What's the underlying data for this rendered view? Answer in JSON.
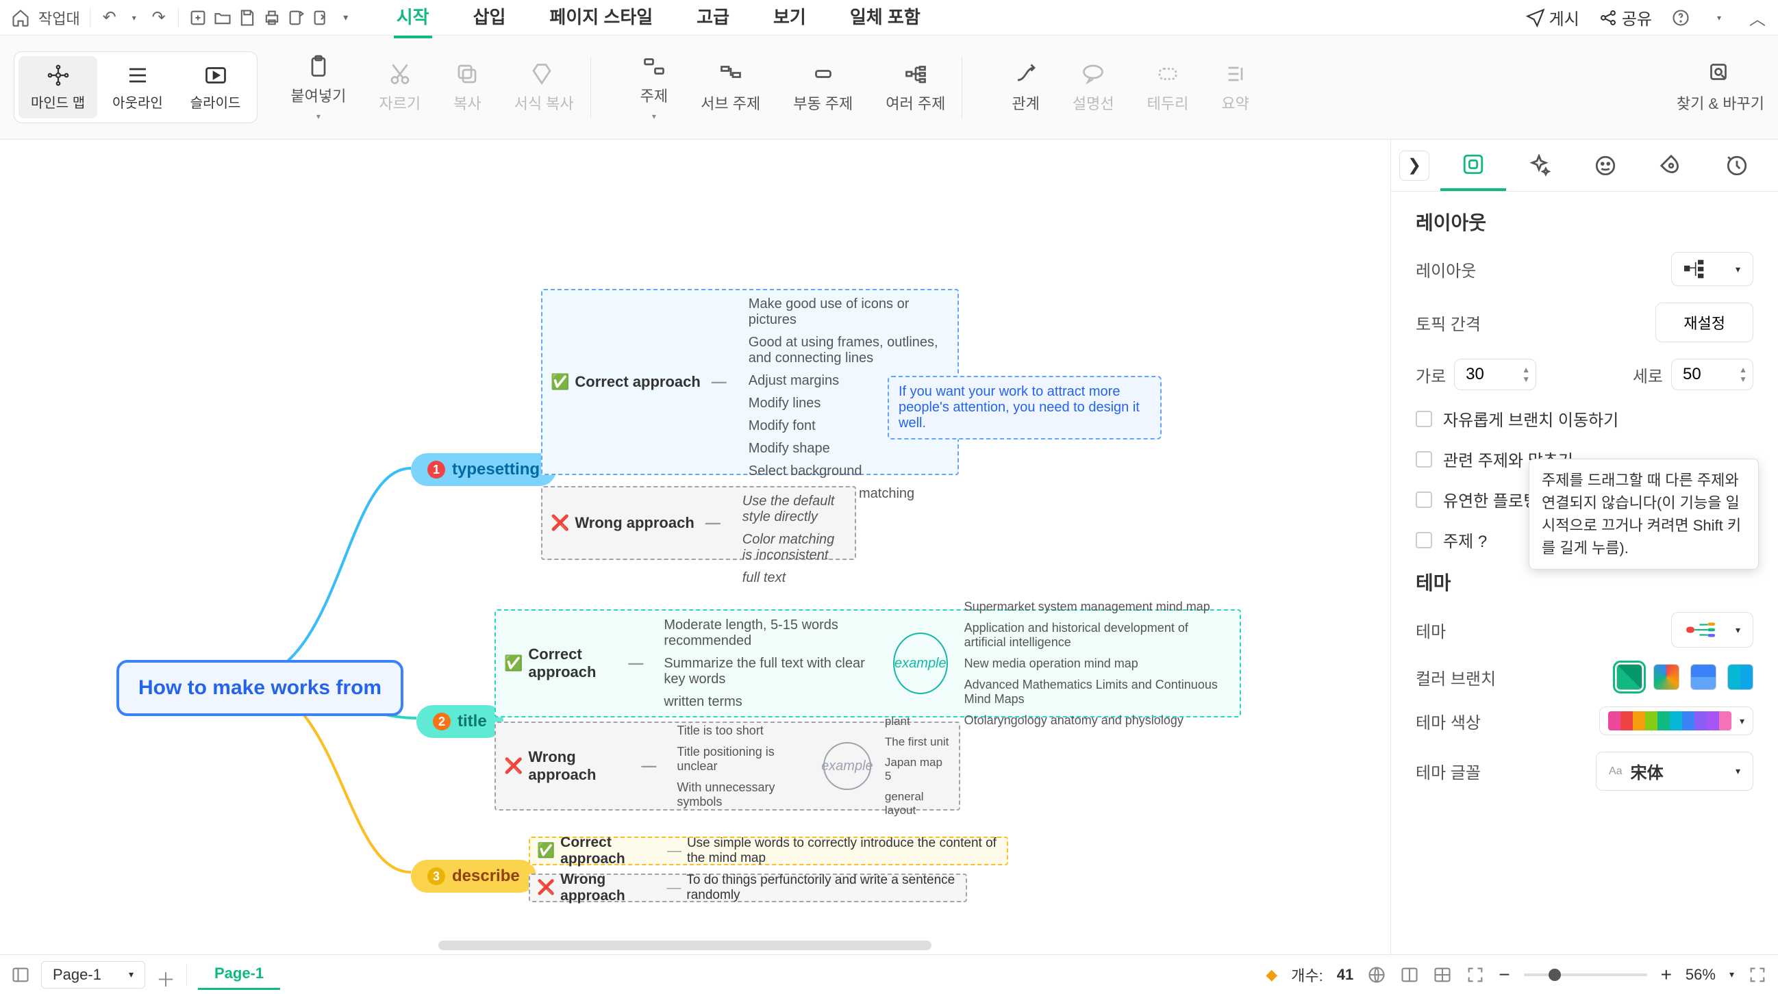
{
  "topbar": {
    "workbench": "작업대",
    "publish": "게시",
    "share": "공유"
  },
  "menus": {
    "start": "시작",
    "insert": "삽입",
    "pageStyle": "페이지 스타일",
    "advanced": "고급",
    "view": "보기",
    "allInclude": "일체 포함"
  },
  "views": {
    "mindmap": "마인드 맵",
    "outline": "아웃라인",
    "slides": "슬라이드"
  },
  "ribbon": {
    "paste": "붙여넣기",
    "cut": "자르기",
    "copy": "복사",
    "formatCopy": "서식 복사",
    "topic": "주제",
    "subTopic": "서브 주제",
    "floatTopic": "부동 주제",
    "multiTopic": "여러 주제",
    "relation": "관계",
    "note": "설명선",
    "border": "테두리",
    "summary": "요약",
    "findReplace": "찾기 & 바꾸기"
  },
  "panel": {
    "title": "레이아웃",
    "layoutLabel": "레이아웃",
    "topicSpacing": "토픽 간격",
    "reset": "재설정",
    "horiz": "가로",
    "horizVal": "30",
    "vert": "세로",
    "vertVal": "50",
    "freeMove": "자유롭게 브랜치 이동하기",
    "alignRelated": "관련 주제와 맞추기",
    "flexibleFloat": "유연한 플로팅 주제",
    "subjectPartial": "주제 ?",
    "tooltip": "주제를 드래그할 때 다른 주제와 연결되지 않습니다(이 기능을 일시적으로 끄거나 켜려면 Shift 키를 길게 누름).",
    "themeTitle": "테마",
    "themeLabel": "테마",
    "colorBranch": "컬러 브랜치",
    "themeColor": "테마 색상",
    "themeFont": "테마 글꼴",
    "fontValue": "宋体"
  },
  "bottom": {
    "pageSelect": "Page-1",
    "pageTab": "Page-1",
    "countLabel": "개수:",
    "countValue": "41",
    "zoom": "56%"
  },
  "mindmap": {
    "root": "How to make works from",
    "branches": [
      {
        "num": "1",
        "label": "typesetting"
      },
      {
        "num": "2",
        "label": "title"
      },
      {
        "num": "3",
        "label": "describe"
      }
    ],
    "typesetting_correct_title": "Correct approach",
    "typesetting_correct": [
      "Make good use of icons or pictures",
      "Good at using frames, outlines, and connecting lines",
      "Adjust margins",
      "Modify lines",
      "Modify font",
      "Modify shape",
      "Select background",
      "Reasonable color matching"
    ],
    "typesetting_callout": "If you want your work to attract more people's attention, you need to design it well.",
    "typesetting_wrong_title": "Wrong approach",
    "typesetting_wrong": [
      "Use the default style directly",
      "Color matching is inconsistent",
      "full text"
    ],
    "title_correct_title": "Correct approach",
    "title_correct": [
      "Moderate length, 5-15 words recommended",
      "Summarize the full text with clear key words",
      "written terms"
    ],
    "example_label": "example",
    "title_examples": [
      "Supermarket system management mind map",
      "Application and historical development of artificial intelligence",
      "New media operation mind map",
      "Advanced Mathematics Limits and Continuous Mind Maps",
      "Otolaryngology anatomy and physiology"
    ],
    "title_wrong_title": "Wrong approach",
    "title_wrong": [
      "Title is too short",
      "Title positioning is unclear",
      "With unnecessary symbols"
    ],
    "title_wrong_examples": [
      "plant",
      "The first unit",
      "Japan map 5",
      "general layout"
    ],
    "describe_correct_title": "Correct approach",
    "describe_correct": "Use simple words to correctly introduce the content of the mind map",
    "describe_wrong_title": "Wrong approach",
    "describe_wrong": "To do things perfunctorily and write a sentence randomly"
  }
}
